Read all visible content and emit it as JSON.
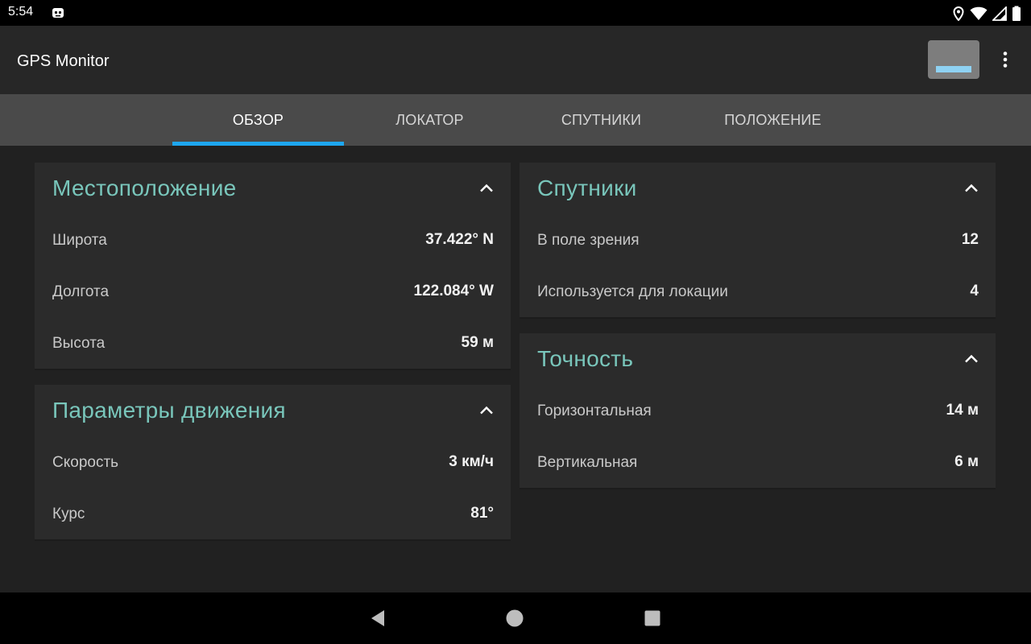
{
  "status_bar": {
    "time": "5:54",
    "icons": [
      "notification-robot-icon",
      "location-pin-icon",
      "wifi-icon",
      "signal-icon",
      "battery-icon"
    ]
  },
  "app_bar": {
    "title": "GPS Monitor",
    "actions": [
      "preview-thumbnail",
      "more-vert-icon"
    ]
  },
  "tabs": [
    {
      "label": "ОБЗОР",
      "active": true
    },
    {
      "label": "ЛОКАТОР",
      "active": false
    },
    {
      "label": "СПУТНИКИ",
      "active": false
    },
    {
      "label": "ПОЛОЖЕНИЕ",
      "active": false
    }
  ],
  "cards": {
    "location": {
      "title": "Местоположение",
      "rows": [
        {
          "label": "Широта",
          "value": "37.422° N"
        },
        {
          "label": "Долгота",
          "value": "122.084° W"
        },
        {
          "label": "Высота",
          "value": "59 м"
        }
      ]
    },
    "motion": {
      "title": "Параметры движения",
      "rows": [
        {
          "label": "Скорость",
          "value": "3 км/ч"
        },
        {
          "label": "Курс",
          "value": "81°"
        }
      ]
    },
    "satellites": {
      "title": "Спутники",
      "rows": [
        {
          "label": "В поле зрения",
          "value": "12"
        },
        {
          "label": "Используется для локации",
          "value": "4"
        }
      ]
    },
    "accuracy": {
      "title": "Точность",
      "rows": [
        {
          "label": "Горизонтальная",
          "value": "14 м"
        },
        {
          "label": "Вертикальная",
          "value": "6 м"
        }
      ]
    }
  },
  "colors": {
    "accent": "#79c6bb",
    "tab_indicator": "#1ea7f0",
    "card_bg": "#2b2b2b",
    "page_bg": "#212121"
  },
  "nav_bar": {
    "buttons": [
      "back-icon",
      "home-icon",
      "recents-icon"
    ]
  }
}
